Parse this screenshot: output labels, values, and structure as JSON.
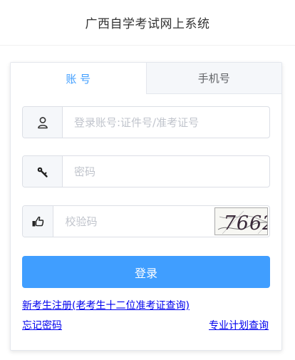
{
  "header": {
    "title": "广西自学考试网上系统"
  },
  "tabs": [
    {
      "label": "账 号",
      "active": true
    },
    {
      "label": "手机号",
      "active": false
    }
  ],
  "form": {
    "account_placeholder": "登录账号:证件号/准考证号",
    "account_value": "",
    "password_placeholder": "密码",
    "password_value": "",
    "captcha_placeholder": "校验码",
    "captcha_value": "",
    "captcha_image_text": "7662",
    "icons": {
      "account": "user-icon",
      "password": "key-icon",
      "captcha": "hand-pointing-icon"
    }
  },
  "login_button": "登录",
  "links": {
    "register": "新考生注册(老考生十二位准考证查询)",
    "forgot": "忘记密码",
    "plan": "专业计划查询"
  },
  "colors": {
    "accent": "#409eff",
    "link": "#0000ee",
    "tab_inactive_bg": "#f5f7fa"
  }
}
